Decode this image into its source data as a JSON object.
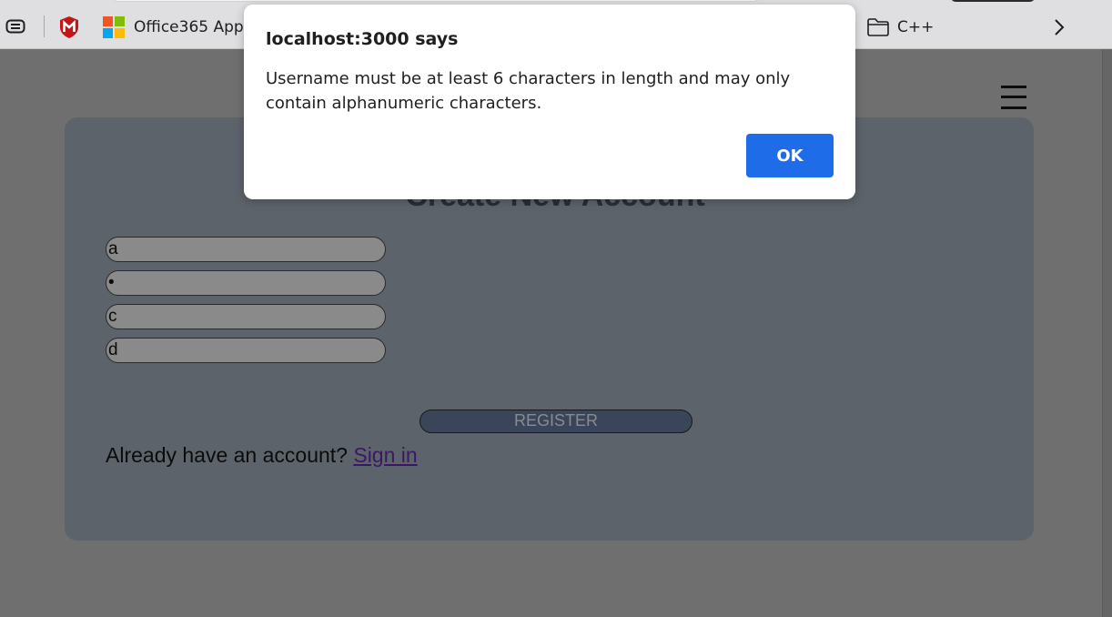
{
  "bookmarks": {
    "items": [
      {
        "label": "Office365 Apps",
        "icon": "microsoft-logo-icon"
      },
      {
        "label": "C++",
        "icon": "folder-icon"
      }
    ]
  },
  "page": {
    "title": "Create New Account",
    "form": {
      "username_value": "a",
      "password_value": "•",
      "field3_value": "c",
      "field4_value": "d"
    },
    "register_label": "REGISTER",
    "signin_prompt": "Already have an account? ",
    "signin_link": "Sign in"
  },
  "dialog": {
    "title": "localhost:3000 says",
    "message": "Username must be at least 6 characters in length and may only contain alphanumeric characters.",
    "ok_label": "OK"
  },
  "colors": {
    "dialog_ok_button": "#1f6ce8",
    "page_backdrop": "#6f6f6f",
    "card": "#5d636b",
    "register_button": "#3a4559",
    "signin_link": "#3d1766"
  }
}
